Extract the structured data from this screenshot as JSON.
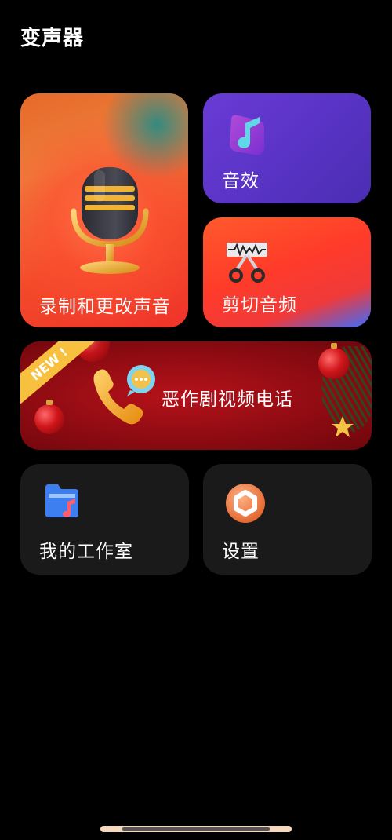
{
  "header": {
    "title": "变声器"
  },
  "cards": {
    "record": {
      "label": "录制和更改声音",
      "icon": "microphone-icon"
    },
    "effects": {
      "label": "音效",
      "icon": "music-note-icon"
    },
    "cut": {
      "label": "剪切音频",
      "icon": "scissors-waveform-icon"
    },
    "prank": {
      "label": "恶作剧视频电话",
      "badge": "NEW !",
      "icon": "phone-chat-icon"
    },
    "studio": {
      "label": "我的工作室",
      "icon": "music-folder-icon"
    },
    "settings": {
      "label": "设置",
      "icon": "gear-icon"
    }
  },
  "colors": {
    "background": "#000000",
    "effects_card": "#5a34c6",
    "record_card": "#f0462a",
    "cut_card": "#ff3b2a",
    "prank_card": "#a50f16",
    "dark_card": "#1a1a1a",
    "badge": "#f7c13f"
  }
}
